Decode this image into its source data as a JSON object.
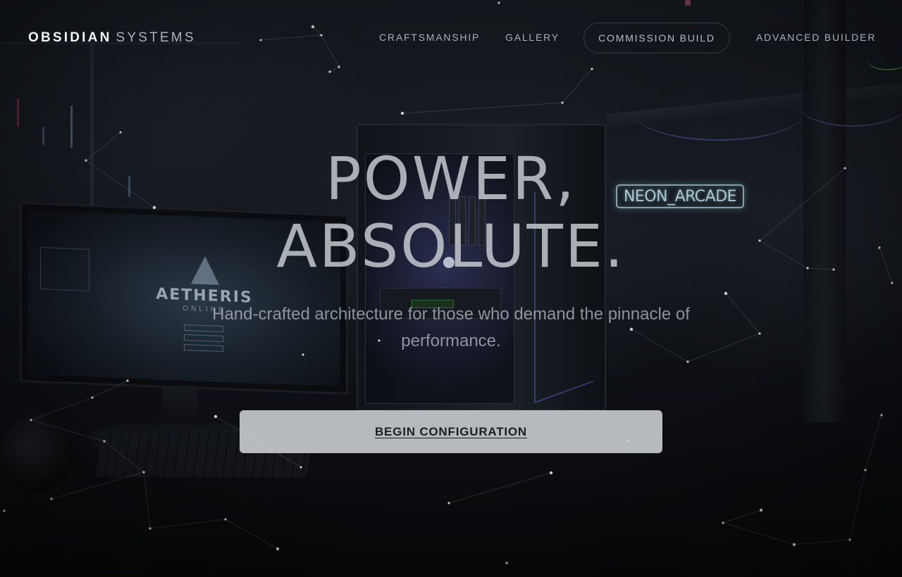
{
  "header": {
    "brand": {
      "strong": "OBSIDIAN",
      "light": "SYSTEMS"
    },
    "nav": {
      "craftsmanship": "CRAFTSMANSHIP",
      "gallery": "GALLERY",
      "commission": "COMMISSION BUILD",
      "advanced": "ADVANCED BUILDER"
    }
  },
  "hero": {
    "title_line1": "POWER,",
    "title_line2": "ABSOLUTE.",
    "subtitle": "Hand-crafted architecture for those who demand the pinnacle of performance.",
    "cta_label": "BEGIN CONFIGURATION"
  },
  "background": {
    "monitor_game_title": "AETHERIS",
    "monitor_game_subtitle": "ONLINE",
    "neon_sign": "NEON_ARCADE"
  },
  "colors": {
    "page_background": "#0b0d10",
    "cta_background": "#d4d6da",
    "nav_text": "#a7b0bc",
    "neon": "#b9d7de",
    "particle": "#e8eef6"
  }
}
